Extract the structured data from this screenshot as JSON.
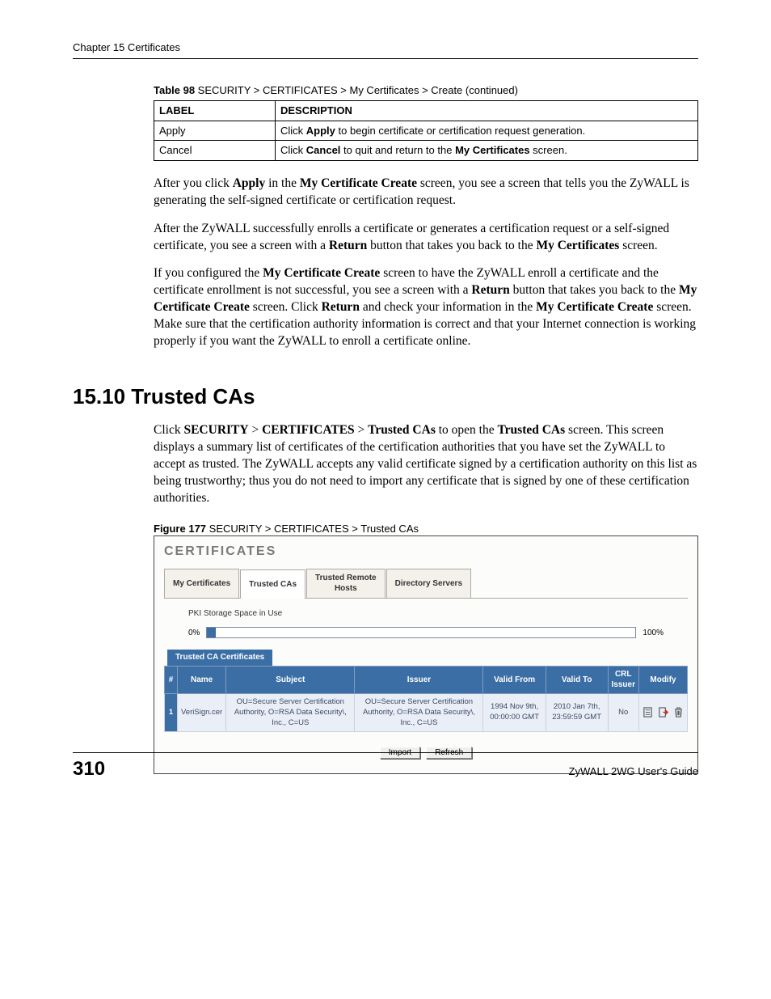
{
  "header": "Chapter 15 Certificates",
  "table98": {
    "caption_bold": "Table 98",
    "caption_rest": "   SECURITY > CERTIFICATES > My Certificates > Create (continued)",
    "head_label": "LABEL",
    "head_desc": "DESCRIPTION",
    "rows": [
      {
        "label": "Apply",
        "desc_pre": "Click ",
        "desc_b1": "Apply",
        "desc_post": " to begin certificate or certification request generation."
      },
      {
        "label": "Cancel",
        "desc_pre": "Click ",
        "desc_b1": "Cancel",
        "desc_mid": " to quit and return to the ",
        "desc_b2": "My Certificates",
        "desc_post": " screen."
      }
    ]
  },
  "para1_a": "After you click ",
  "para1_b1": "Apply",
  "para1_b": " in the ",
  "para1_b2": "My Certificate Create",
  "para1_c": " screen, you see a screen that tells you the ZyWALL is generating the self-signed certificate or certification request.",
  "para2_a": "After the ZyWALL successfully enrolls a certificate or generates a certification request or a self-signed certificate, you see a screen with a ",
  "para2_b1": "Return",
  "para2_b": " button that takes you back to the ",
  "para2_b2": "My Certificates",
  "para2_c": " screen.",
  "para3_a": "If you configured the ",
  "para3_b1": "My Certificate Create",
  "para3_b": " screen to have the ZyWALL enroll a certificate and the certificate enrollment is not successful, you see a screen with a ",
  "para3_b2": "Return",
  "para3_c": " button that takes you back to the ",
  "para3_b3": "My Certificate Create",
  "para3_d": " screen. Click ",
  "para3_b4": "Return",
  "para3_e": " and check your information in the ",
  "para3_b5": "My Certificate Create",
  "para3_f": " screen. Make sure that the certification authority information is correct and that your Internet connection is working properly if you want the ZyWALL to enroll a certificate online.",
  "section_heading": "15.10  Trusted CAs",
  "para4_a": "Click ",
  "para4_b1": "SECURITY",
  "para4_s1": " > ",
  "para4_b2": "CERTIFICATES",
  "para4_s2": " > ",
  "para4_b3": "Trusted CAs",
  "para4_b": " to open the ",
  "para4_b4": "Trusted CAs",
  "para4_c": " screen. This screen displays a summary list of certificates of the certification authorities that you have set the ZyWALL to accept as trusted. The ZyWALL accepts any valid certificate signed by a certification authority on this list as being trustworthy; thus you do not need to import any certificate that is signed by one of these certification authorities.",
  "figure_caption_bold": "Figure 177",
  "figure_caption_rest": "   SECURITY > CERTIFICATES > Trusted CAs",
  "screenshot": {
    "title": "CERTIFICATES",
    "tabs": [
      "My Certificates",
      "Trusted CAs",
      "Trusted Remote\nHosts",
      "Directory Servers"
    ],
    "active_tab": 1,
    "storage_label": "PKI Storage Space in Use",
    "gauge_left": "0%",
    "gauge_value": "2%",
    "gauge_right": "100%",
    "subsection": "Trusted CA Certificates",
    "columns": [
      "#",
      "Name",
      "Subject",
      "Issuer",
      "Valid From",
      "Valid To",
      "CRL\nIssuer",
      "Modify"
    ],
    "rows": [
      {
        "idx": "1",
        "name": "VeriSign.cer",
        "subject": "OU=Secure Server Certification Authority, O=RSA Data Security\\, Inc., C=US",
        "issuer": "OU=Secure Server Certification Authority, O=RSA Data Security\\, Inc., C=US",
        "valid_from": "1994 Nov 9th, 00:00:00 GMT",
        "valid_to": "2010 Jan 7th, 23:59:59 GMT",
        "crl_issuer": "No"
      }
    ],
    "buttons": [
      "Import",
      "Refresh"
    ]
  },
  "footer_page": "310",
  "footer_guide": "ZyWALL 2WG User's Guide"
}
